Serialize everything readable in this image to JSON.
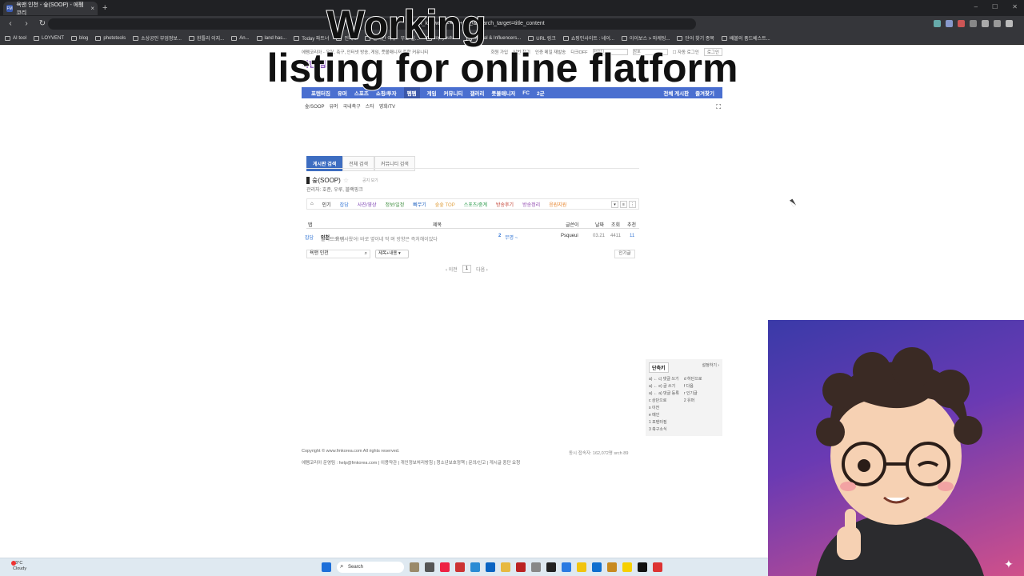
{
  "browser": {
    "tab_title": "욕맨 인천 - 숲(SOOP) - 에펨코리",
    "tab_favicon": "FM",
    "tab_close": "×",
    "new_tab": "+",
    "url_visible": "earch_keyword=욕맨+인천&search_target=title_content",
    "bookmarks": [
      "AI tool",
      "LOYVENT",
      "blog",
      "phototools",
      "소상공인 부업정보...",
      "흰틀리 이지...",
      "An...",
      "land has...",
      "Today 파트너",
      "인재로",
      "실시간 이슈 · 무료 실...",
      "top youtube",
      "Social & Influencers...",
      "URL 링크",
      "쇼핑인사이트 : 네이...",
      "아이보스 > 마케팅...",
      "단어 찾기 종목",
      "배볼의 품드베스트..."
    ]
  },
  "overlay": {
    "line1": "Working",
    "line2": "listing for online flatform"
  },
  "site": {
    "top_desc": "에펨코리아 - 유머, 축구, 인터넷 방송, 게임, 풋볼매니저 종합 커뮤니티",
    "top_links": [
      "회원 가입",
      "비번 찾기",
      "인증 메일 재발송",
      "다크OFF"
    ],
    "id_placeholder": "아이디",
    "pw_placeholder": "암호",
    "auto_login": "자동 로그인",
    "login_btn": "로그인",
    "logo_text": "착한 펨코",
    "gnb": [
      "포텐터짐",
      "유머",
      "스포츠",
      "쇼핑/투자",
      "펨펨",
      "게임",
      "커뮤니티",
      "갤러리",
      "풋볼매니저",
      "FC",
      "2군"
    ],
    "gnb_right": [
      "전체 게시판",
      "즐겨찾기"
    ],
    "gnb_active": "펨펨",
    "subnav": [
      "숲/SOOP",
      "유머",
      "국내축구",
      "스타",
      "영화/TV"
    ],
    "expand_icon": "⛶",
    "search_tabs": [
      "게시판 검색",
      "전체 검색",
      "커뮤니티 검색"
    ],
    "board_name": "숲(SOOP)",
    "board_note": "공지 보기",
    "board_admin": "관리자: 호준, 우루, 블랙핑크",
    "categories": [
      {
        "label": "인기",
        "color": "#222"
      },
      {
        "label": "잡담",
        "color": "#3b7bd6"
      },
      {
        "label": "사진/영상",
        "color": "#7a3fb1"
      },
      {
        "label": "정보/일정",
        "color": "#3a8a3a"
      },
      {
        "label": "빠무기",
        "color": "#1b5fbf"
      },
      {
        "label": "숲숲 TOP",
        "color": "#e0a040"
      },
      {
        "label": "스포츠/중계",
        "color": "#2a9a4a"
      },
      {
        "label": "방송후기",
        "color": "#c0392b"
      },
      {
        "label": "방송정리",
        "color": "#8e44ad"
      },
      {
        "label": "응원지원",
        "color": "#e67e22"
      }
    ],
    "home_icon": "⌂",
    "table_headers": {
      "tab": "탭",
      "title": "제목",
      "author": "글쓴이",
      "date": "날짜",
      "views": "조회",
      "votes": "추천"
    },
    "row": {
      "tab": "잡담",
      "title_pre": "클리드 욕맨 ",
      "title_bold": "인천",
      "title_post": "으로 이사왔어! 바로 옆이네 딱 며 방향은 즉처해이었다",
      "comments": "2",
      "extra": "무명 ~",
      "author": "Psqueui",
      "date": "03.21",
      "views": "4411",
      "votes": "11"
    },
    "search_value": "욕맨 인천",
    "search_select": "제목+내용",
    "popular_btn": "인기글",
    "pager": {
      "prev": "‹ 이전",
      "current": "1",
      "next": "다음 ›"
    },
    "shortcuts": {
      "title": "단축키",
      "more": "설정하기 ›",
      "left": [
        "a) ← c) 댓글 쓰기",
        "a) ← e) 글 쓰기",
        "a) ← a) 댓글 등록",
        "c 상단으로",
        "s 이전",
        "e 메인",
        "1 포텐터짐",
        "3 축구소식"
      ],
      "right": [
        "d 하단으로",
        "f 다음",
        "r 인기글",
        "2 유머"
      ]
    },
    "footer_copy": "Copyright © www.fmkorea.com All rights reserved.",
    "footer_links": "에펨코리아 운영팀 : help@fmkorea.com | 이용약관 | 개인정보처리방침 | 청소년보호정책 | 문의/신고 | 게시글 중단 요청",
    "footer_right": "동시 접속자: 162,072명 srch 89"
  },
  "taskbar": {
    "temp": "13°C",
    "condition": "Cloudy",
    "search": "Search"
  },
  "colors": {
    "gnb": "#4a6fd0",
    "tab_active": "#3d6dc1",
    "avatar_bg": "#5a3ab0"
  }
}
